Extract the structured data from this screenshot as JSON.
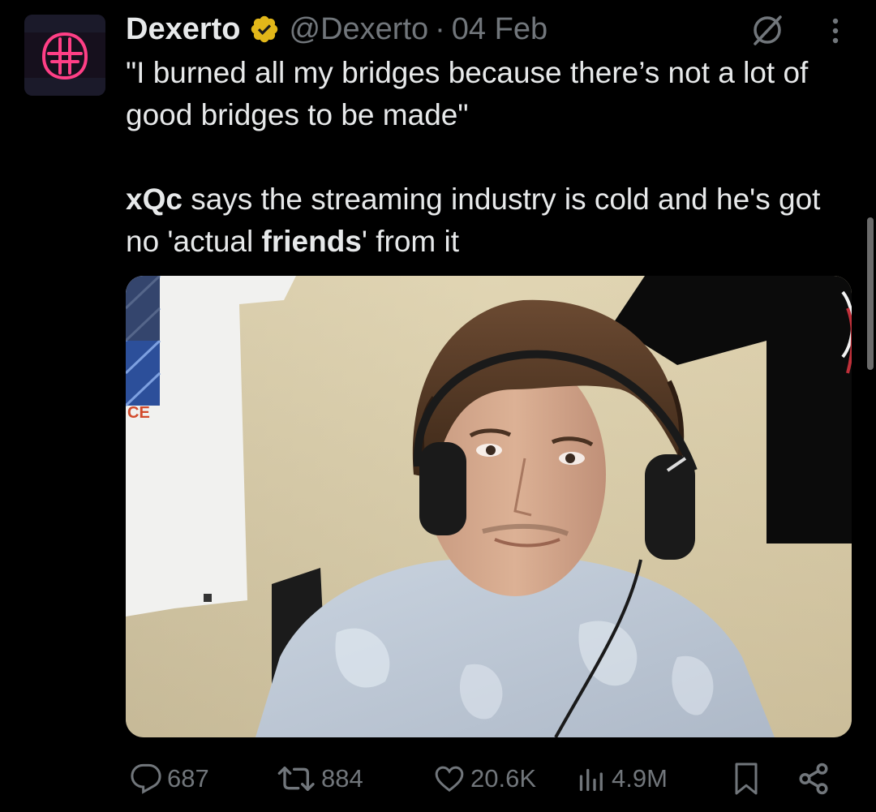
{
  "tweet": {
    "author_name": "Dexerto",
    "handle": "@Dexerto",
    "separator": "·",
    "date": "04 Feb",
    "quote": "\"I burned all my bridges because there’s not a lot of good bridges to be made\"",
    "body_part1": "xQc",
    "body_part2": " says the streaming industry is cold and he's got no 'actual ",
    "body_part3": "friends",
    "body_part4": "' from it"
  },
  "actions": {
    "replies": "687",
    "reposts": "884",
    "likes": "20.6K",
    "views": "4.9M"
  },
  "icons": [
    "verified-badge-icon",
    "grok-icon",
    "more-icon",
    "reply-icon",
    "repost-icon",
    "like-icon",
    "views-icon",
    "bookmark-icon",
    "share-icon"
  ],
  "colors": {
    "background": "#000000",
    "text": "#e7e9ea",
    "muted": "#71767b",
    "verified": "#e2b719",
    "logo_neon": "#ff3f86"
  }
}
